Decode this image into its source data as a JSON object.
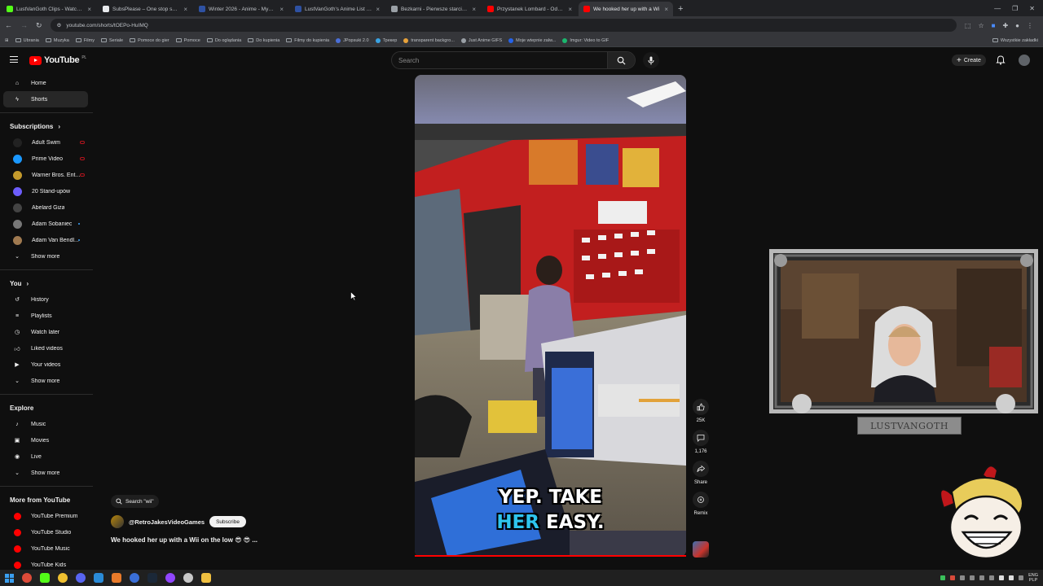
{
  "browser": {
    "tabs": [
      {
        "title": "LustVanGoth Clips - Watch Liv",
        "color": "#53fc18",
        "active": false
      },
      {
        "title": "SubsPlease – One stop shop fo",
        "color": "#e8eaed",
        "active": false
      },
      {
        "title": "Winter 2026 - Anime - MyAnim",
        "color": "#2e51a2",
        "active": false
      },
      {
        "title": "LustVanGoth's Anime List - My",
        "color": "#2e51a2",
        "active": false
      },
      {
        "title": "Bezkarni - Pierwsze starcie / Th",
        "color": "#9aa0a6",
        "active": false
      },
      {
        "title": "Przystanek Lombard - Odc. 92",
        "color": "#ff0000",
        "active": false
      },
      {
        "title": "We hooked her up with a Wi",
        "color": "#ff0000",
        "active": true
      }
    ],
    "url": "youtube.com/shorts/tOEPo-HuIMQ",
    "bookmarks": [
      {
        "label": "Ubrania",
        "kind": "folder"
      },
      {
        "label": "Muzyka",
        "kind": "folder"
      },
      {
        "label": "Filmy",
        "kind": "folder"
      },
      {
        "label": "Seriale",
        "kind": "folder"
      },
      {
        "label": "Pomoce do gier",
        "kind": "folder"
      },
      {
        "label": "Pomoce",
        "kind": "folder"
      },
      {
        "label": "Do oglądania",
        "kind": "folder"
      },
      {
        "label": "Do kupienia",
        "kind": "folder"
      },
      {
        "label": "Filmy do kupienia",
        "kind": "folder"
      },
      {
        "label": "JPopsuki 2.0",
        "kind": "site",
        "color": "#4a6fd8"
      },
      {
        "label": "Трекер",
        "kind": "site",
        "color": "#3aa3e3"
      },
      {
        "label": "transparent backgro...",
        "kind": "site",
        "color": "#e8a23a"
      },
      {
        "label": "Just Anime GIFS",
        "kind": "site",
        "color": "#9aa0a6"
      },
      {
        "label": "Moje wtepnie zalw...",
        "kind": "site",
        "color": "#2563eb"
      },
      {
        "label": "Imgur: Video to GIF",
        "kind": "site",
        "color": "#1bb76e"
      }
    ],
    "bookmarks_right": "Wszystkie zakładki"
  },
  "header": {
    "logo_text": "YouTube",
    "logo_region": "PL",
    "search_placeholder": "Search",
    "create_label": "Create"
  },
  "sidebar": {
    "main": [
      {
        "label": "Home",
        "icon": "home-icon",
        "active": false
      },
      {
        "label": "Shorts",
        "icon": "shorts-icon",
        "active": true
      }
    ],
    "subscriptions_title": "Subscriptions",
    "subscriptions": [
      {
        "label": "Adult Swim",
        "color": "#222",
        "badge": "live"
      },
      {
        "label": "Prime Video",
        "color": "#1a98ff",
        "badge": "live"
      },
      {
        "label": "Warner Bros. Ent...",
        "color": "#c49a2c",
        "badge": "live"
      },
      {
        "label": "20 Stand-upów",
        "color": "#6d5dfc",
        "badge": ""
      },
      {
        "label": "Abelard Giza",
        "color": "#444",
        "badge": ""
      },
      {
        "label": "Adam Sobaniec",
        "color": "#777",
        "badge": "dot"
      },
      {
        "label": "Adam Van Bendl...",
        "color": "#a07a50",
        "badge": "dot"
      }
    ],
    "show_more": "Show more",
    "you_title": "You",
    "you": [
      {
        "label": "History",
        "icon": "history-icon"
      },
      {
        "label": "Playlists",
        "icon": "playlists-icon"
      },
      {
        "label": "Watch later",
        "icon": "watch-later-icon"
      },
      {
        "label": "Liked videos",
        "icon": "liked-icon"
      },
      {
        "label": "Your videos",
        "icon": "your-videos-icon"
      }
    ],
    "explore_title": "Explore",
    "explore": [
      {
        "label": "Music",
        "icon": "music-icon"
      },
      {
        "label": "Movies",
        "icon": "movies-icon"
      },
      {
        "label": "Live",
        "icon": "live-icon"
      }
    ],
    "more_title": "More from YouTube",
    "more": [
      {
        "label": "YouTube Premium"
      },
      {
        "label": "YouTube Studio"
      },
      {
        "label": "YouTube Music"
      },
      {
        "label": "YouTube Kids"
      }
    ]
  },
  "short": {
    "search_chip": "Search \"wii\"",
    "channel": "@RetroJakesVideoGames",
    "subscribe": "Subscribe",
    "title": "We hooked her up with a Wii on the low 😎 😎 ...",
    "caption_line1": "YEP. TAKE",
    "caption_word_highlight": "HER",
    "caption_word_rest": "EASY.",
    "likes": "25K",
    "comments": "1,176",
    "share": "Share",
    "remix": "Remix"
  },
  "overlay": {
    "streamer_name": "LUSTVANGOTH"
  },
  "taskbar": {
    "lang_top": "ENG",
    "lang_bottom": "PLP"
  }
}
